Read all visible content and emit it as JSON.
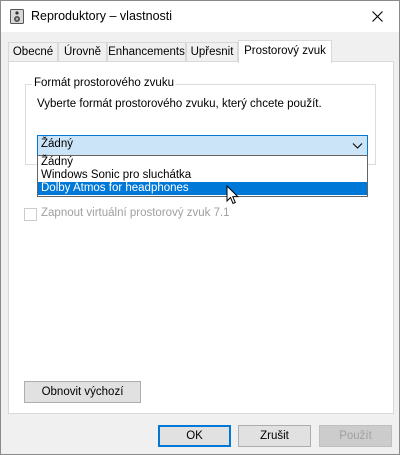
{
  "window": {
    "title": "Reproduktory – vlastnosti"
  },
  "tabs": [
    {
      "label": "Obecné",
      "active": false
    },
    {
      "label": "Úrovně",
      "active": false
    },
    {
      "label": "Enhancements",
      "active": false
    },
    {
      "label": "Upřesnit",
      "active": false
    },
    {
      "label": "Prostorový zvuk",
      "active": true
    }
  ],
  "spatial": {
    "group_title": "Formát prostorového zvuku",
    "description": "Vyberte formát prostorového zvuku, který chcete použít.",
    "combo_value": "Žádný",
    "options": [
      "Žádný",
      "Windows Sonic pro sluchátka",
      "Dolby Atmos for headphones"
    ],
    "highlighted_option": "Dolby Atmos for headphones",
    "checkbox_label": "Zapnout virtuální prostorový zvuk 7.1",
    "checkbox_checked": false
  },
  "buttons": {
    "restore": "Obnovit výchozí",
    "ok": "OK",
    "cancel": "Zrušit",
    "apply": "Použít"
  },
  "colors": {
    "accent": "#0078d7",
    "combo_fill": "#cce4f7",
    "disabled_text": "#a0a0a0"
  }
}
